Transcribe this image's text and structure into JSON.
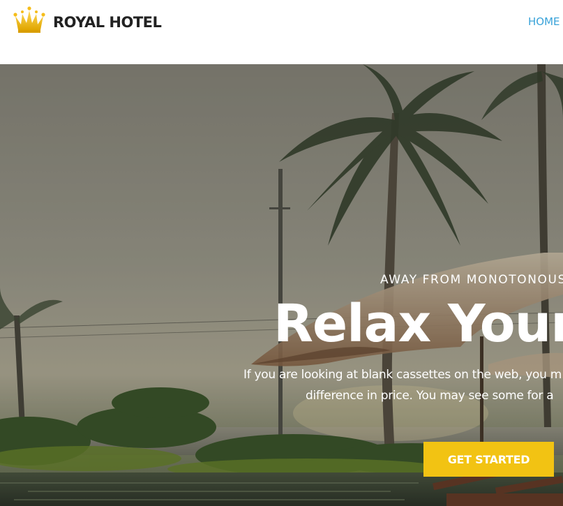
{
  "header": {
    "logo_text": "ROYAL HOTEL",
    "nav": {
      "home_label": "HOME"
    }
  },
  "hero": {
    "subtitle": "AWAY FROM MONOTONOUS",
    "title": "Relax Your",
    "text_line_1": "If you are looking at blank cassettes on the web, you m",
    "text_line_2": "difference in price. You may see some for a",
    "cta_label": "GET STARTED"
  },
  "colors": {
    "brand_yellow": "#f2c313",
    "nav_link": "#3aa3d9",
    "logo_text": "#222222"
  },
  "icons": {
    "logo_icon": "crown-icon"
  }
}
